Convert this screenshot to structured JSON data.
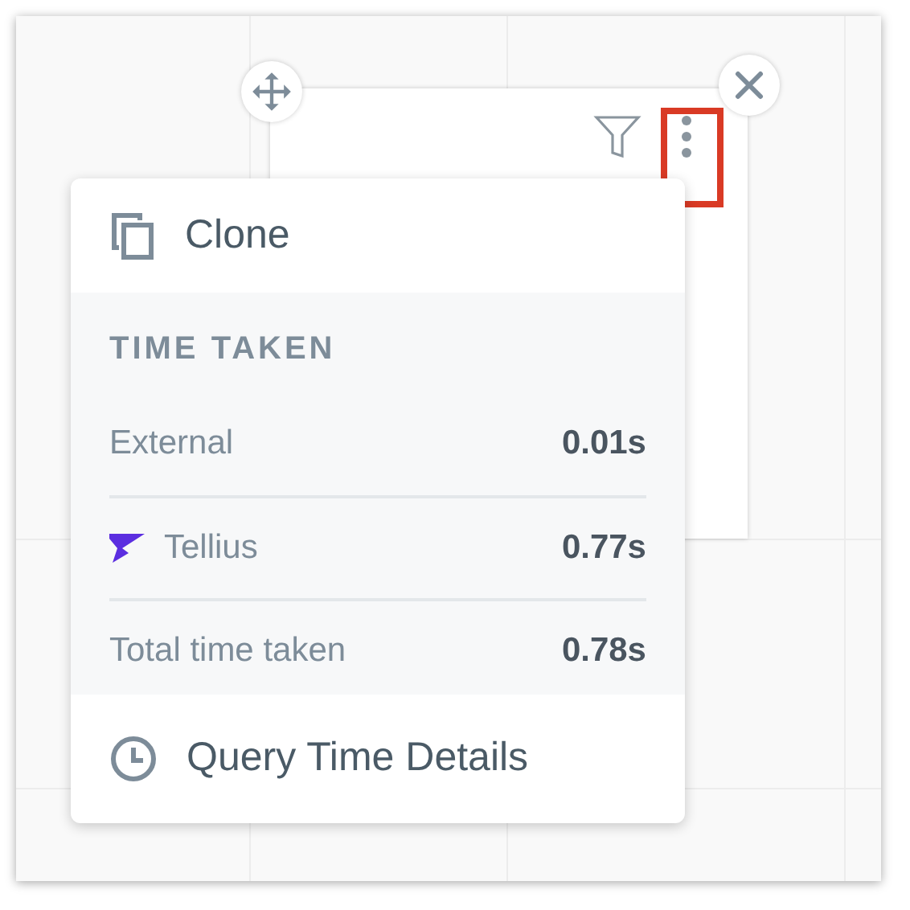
{
  "menu": {
    "clone": {
      "label": "Clone"
    },
    "time_taken": {
      "heading": "TIME TAKEN",
      "rows": [
        {
          "kind": "plain",
          "label": "External",
          "value": "0.01s"
        },
        {
          "kind": "brand",
          "label": "Tellius",
          "value": "0.77s"
        },
        {
          "kind": "plain",
          "label": "Total time taken",
          "value": "0.78s"
        }
      ]
    },
    "query_details": {
      "label": "Query Time Details"
    }
  }
}
